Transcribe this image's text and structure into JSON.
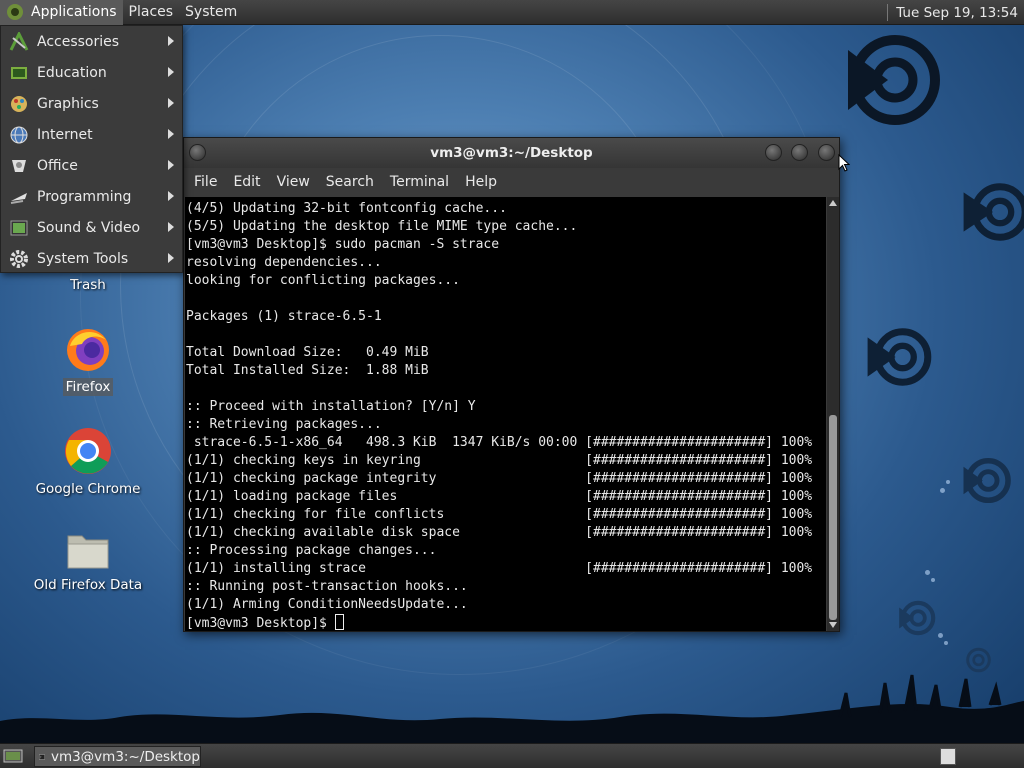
{
  "top_panel": {
    "menus": [
      {
        "label": "Applications",
        "icon": "gnome-foot-icon",
        "active": true
      },
      {
        "label": "Places"
      },
      {
        "label": "System"
      }
    ],
    "clock": "Tue Sep 19, 13:54"
  },
  "apps_menu": {
    "items": [
      {
        "label": "Accessories",
        "icon": "accessories-icon"
      },
      {
        "label": "Education",
        "icon": "education-icon"
      },
      {
        "label": "Graphics",
        "icon": "graphics-icon"
      },
      {
        "label": "Internet",
        "icon": "internet-globe-icon"
      },
      {
        "label": "Office",
        "icon": "office-icon"
      },
      {
        "label": "Programming",
        "icon": "programming-icon"
      },
      {
        "label": "Sound & Video",
        "icon": "sound-video-icon"
      },
      {
        "label": "System Tools",
        "icon": "system-tools-gear-icon"
      }
    ]
  },
  "desktop": {
    "icons": [
      {
        "label": "Trash",
        "icon": "trash-icon"
      },
      {
        "label": "Firefox",
        "icon": "firefox-icon",
        "selected": true
      },
      {
        "label": "Google Chrome",
        "icon": "chrome-icon"
      },
      {
        "label": "Old Firefox Data",
        "icon": "folder-icon"
      }
    ]
  },
  "terminal": {
    "title": "vm3@vm3:~/Desktop",
    "menu": [
      "File",
      "Edit",
      "View",
      "Search",
      "Terminal",
      "Help"
    ],
    "lines": [
      "(4/5) Updating 32-bit fontconfig cache...",
      "(5/5) Updating the desktop file MIME type cache...",
      "[vm3@vm3 Desktop]$ sudo pacman -S strace",
      "resolving dependencies...",
      "looking for conflicting packages...",
      "",
      "Packages (1) strace-6.5-1",
      "",
      "Total Download Size:   0.49 MiB",
      "Total Installed Size:  1.88 MiB",
      "",
      ":: Proceed with installation? [Y/n] Y",
      ":: Retrieving packages...",
      " strace-6.5-1-x86_64   498.3 KiB  1347 KiB/s 00:00 [######################] 100%",
      "(1/1) checking keys in keyring                     [######################] 100%",
      "(1/1) checking package integrity                   [######################] 100%",
      "(1/1) loading package files                        [######################] 100%",
      "(1/1) checking for file conflicts                  [######################] 100%",
      "(1/1) checking available disk space                [######################] 100%",
      ":: Processing package changes...",
      "(1/1) installing strace                            [######################] 100%",
      ":: Running post-transaction hooks...",
      "(1/1) Arming ConditionNeedsUpdate..."
    ],
    "prompt": "[vm3@vm3 Desktop]$ ",
    "scroll_position": 0.5
  },
  "taskbar": {
    "window_label": "vm3@vm3:~/Desktop",
    "window_icon": "terminal-icon",
    "show_desktop_icon": "show-desktop-icon",
    "workspace_icon": "workspace-switcher-icon"
  },
  "colors": {
    "panel": "#3a3a3a",
    "terminal_bg": "#000000",
    "terminal_fg": "#e8e8e8",
    "desktop_accent": "#2c5a8e"
  }
}
